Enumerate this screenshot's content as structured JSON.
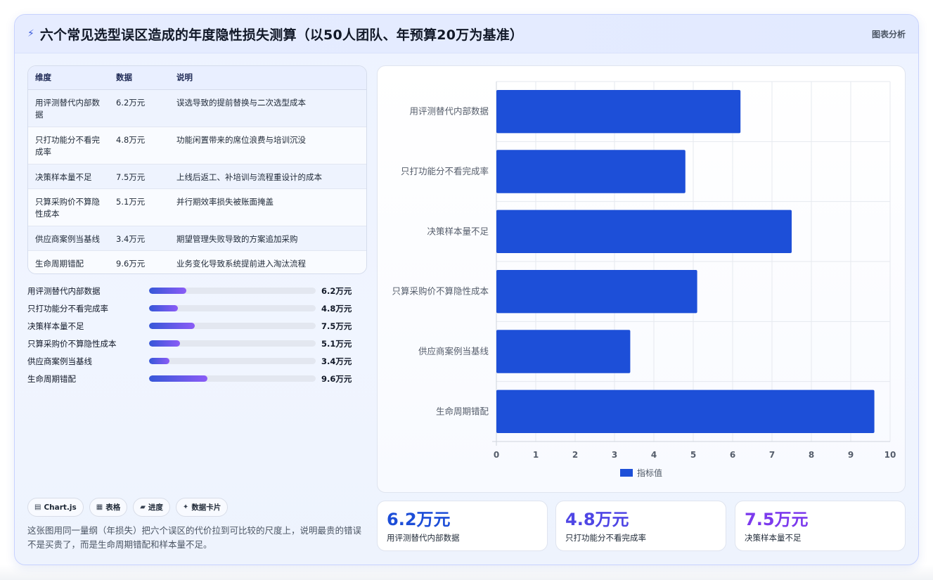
{
  "header": {
    "title": "六个常见选型误区造成的年度隐性损失测算（以50人团队、年预算20万为基准）",
    "tag": "图表分析"
  },
  "table": {
    "headers": [
      "维度",
      "数据",
      "说明"
    ],
    "rows": [
      {
        "dim": "用评测替代内部数据",
        "val": "6.2万元",
        "desc": "误选导致的提前替换与二次选型成本"
      },
      {
        "dim": "只打功能分不看完成率",
        "val": "4.8万元",
        "desc": "功能闲置带来的席位浪费与培训沉没"
      },
      {
        "dim": "决策样本量不足",
        "val": "7.5万元",
        "desc": "上线后返工、补培训与流程重设计的成本"
      },
      {
        "dim": "只算采购价不算隐性成本",
        "val": "5.1万元",
        "desc": "并行期效率损失被账面掩盖"
      },
      {
        "dim": "供应商案例当基线",
        "val": "3.4万元",
        "desc": "期望管理失败导致的方案追加采购"
      },
      {
        "dim": "生命周期错配",
        "val": "9.6万元",
        "desc": "业务变化导致系统提前进入淘汰流程"
      }
    ]
  },
  "progress": [
    {
      "label": "用评测替代内部数据",
      "value": 6.2,
      "text": "6.2万元"
    },
    {
      "label": "只打功能分不看完成率",
      "value": 4.8,
      "text": "4.8万元"
    },
    {
      "label": "决策样本量不足",
      "value": 7.5,
      "text": "7.5万元"
    },
    {
      "label": "只算采购价不算隐性成本",
      "value": 5.1,
      "text": "5.1万元"
    },
    {
      "label": "供应商案例当基线",
      "value": 3.4,
      "text": "3.4万元"
    },
    {
      "label": "生命周期错配",
      "value": 9.6,
      "text": "9.6万元"
    }
  ],
  "progress_max": 27.5,
  "chips": [
    {
      "icon": "chart-icon",
      "glyph": "▤",
      "label": "Chart.js"
    },
    {
      "icon": "table-icon",
      "glyph": "▦",
      "label": "表格"
    },
    {
      "icon": "progress-icon",
      "glyph": "▰",
      "label": "进度"
    },
    {
      "icon": "spark-icon",
      "glyph": "✦",
      "label": "数据卡片"
    }
  ],
  "summary": "这张图用同一量纲（年损失）把六个误区的代价拉到可比较的尺度上，说明最贵的错误不是买贵了，而是生命周期错配和样本量不足。",
  "kpis": [
    {
      "value": "6.2万元",
      "label": "用评测替代内部数据",
      "color": "#1d4ed8"
    },
    {
      "value": "4.8万元",
      "label": "只打功能分不看完成率",
      "color": "#4f46e5"
    },
    {
      "value": "7.5万元",
      "label": "决策样本量不足",
      "color": "#7c3aed"
    }
  ],
  "colors": {
    "bar": "#1d4fd8",
    "accent": "#3b5bdb"
  },
  "chart_data": {
    "type": "bar",
    "orientation": "horizontal",
    "categories": [
      "用评测替代内部数据",
      "只打功能分不看完成率",
      "决策样本量不足",
      "只算采购价不算隐性成本",
      "供应商案例当基线",
      "生命周期错配"
    ],
    "series": [
      {
        "name": "指标值",
        "values": [
          6.2,
          4.8,
          7.5,
          5.1,
          3.4,
          9.6
        ]
      }
    ],
    "xlim": [
      0,
      10
    ],
    "xticks": [
      "0",
      "1",
      "2",
      "3",
      "4",
      "5",
      "6",
      "7",
      "8",
      "9",
      "10"
    ],
    "grid": true,
    "legend": "bottom"
  }
}
